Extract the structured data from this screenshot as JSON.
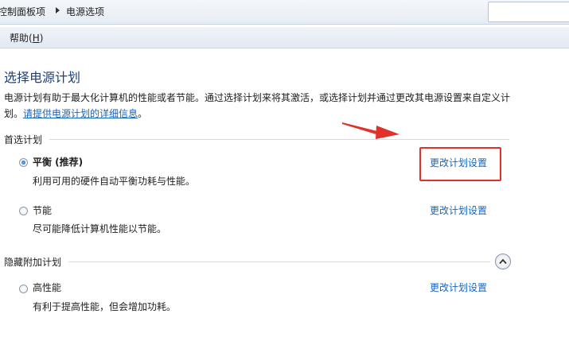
{
  "breadcrumb": {
    "parent": "控制面板项",
    "current": "电源选项"
  },
  "menu": {
    "help_label": "帮助(",
    "help_key": "H",
    "help_close": ")"
  },
  "page": {
    "title": "选择电源计划",
    "description": "电源计划有助于最大化计算机的性能或者节能。通过选择计划来将其激活，或选择计划并通过更改其电源设置来自定义计划。",
    "description_link": "请提供电源计划的详细信息",
    "description_end": "。"
  },
  "preferred_plans": {
    "label": "首选计划",
    "plans": [
      {
        "name": "平衡 (推荐)",
        "description": "利用可用的硬件自动平衡功耗与性能。",
        "link": "更改计划设置",
        "selected": true
      },
      {
        "name": "节能",
        "description": "尽可能降低计算机性能以节能。",
        "link": "更改计划设置",
        "selected": false
      }
    ]
  },
  "hidden_plans": {
    "label": "隐藏附加计划",
    "plans": [
      {
        "name": "高性能",
        "description": "有利于提高性能，但会增加功耗。",
        "link": "更改计划设置",
        "selected": false
      }
    ]
  },
  "colors": {
    "link": "#1665c0",
    "title": "#1f3f78",
    "annotation": "#e0312a"
  },
  "icons": {
    "collapse": "chevron-up-icon",
    "annotation": "red-arrow-icon"
  }
}
